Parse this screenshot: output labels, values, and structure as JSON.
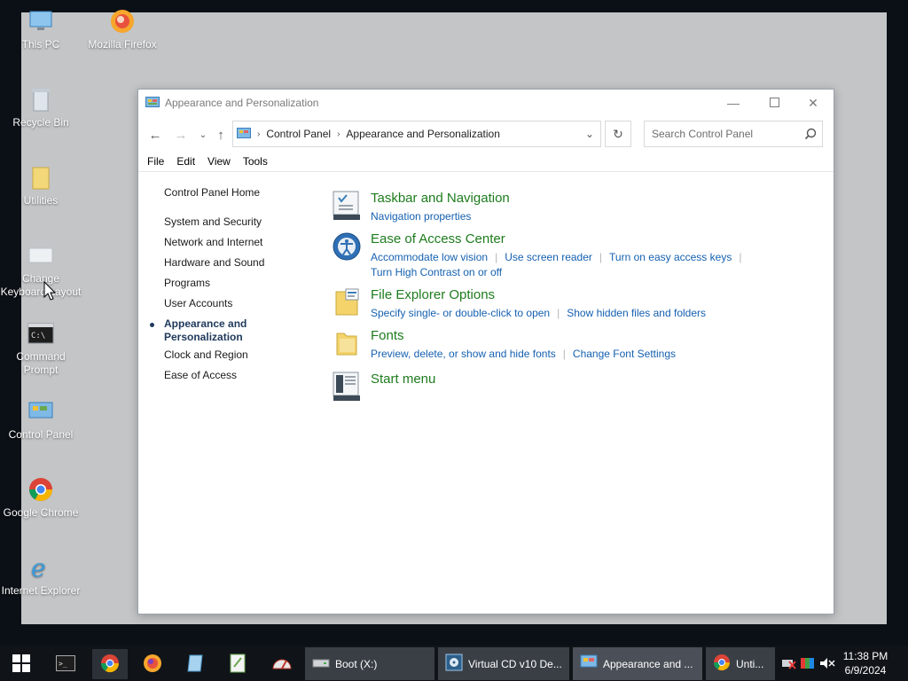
{
  "desktop": {
    "icons": [
      {
        "label": "This PC"
      },
      {
        "label": "Mozilla Firefox"
      },
      {
        "label": "Recycle Bin"
      },
      {
        "label": "Utilities"
      },
      {
        "label": "Change Keyboard Layout"
      },
      {
        "label": "Command Prompt"
      },
      {
        "label": "Control Panel"
      },
      {
        "label": "Google Chrome"
      },
      {
        "label": "Internet Explorer"
      }
    ]
  },
  "window": {
    "title": "Appearance and Personalization",
    "breadcrumb": [
      "Control Panel",
      "Appearance and Personalization"
    ],
    "search_placeholder": "Search Control Panel",
    "menu": [
      "File",
      "Edit",
      "View",
      "Tools"
    ],
    "left_nav": {
      "home": "Control Panel Home",
      "items": [
        "System and Security",
        "Network and Internet",
        "Hardware and Sound",
        "Programs",
        "User Accounts"
      ],
      "current_line1": "Appearance and",
      "current_line2": "Personalization",
      "after": [
        "Clock and Region",
        "Ease of Access"
      ]
    },
    "categories": [
      {
        "title": "Taskbar and Navigation",
        "links": [
          "Navigation properties"
        ]
      },
      {
        "title": "Ease of Access Center",
        "links": [
          "Accommodate low vision",
          "Use screen reader",
          "Turn on easy access keys",
          "Turn High Contrast on or off"
        ]
      },
      {
        "title": "File Explorer Options",
        "links": [
          "Specify single- or double-click to open",
          "Show hidden files and folders"
        ]
      },
      {
        "title": "Fonts",
        "links": [
          "Preview, delete, or show and hide fonts",
          "Change Font Settings"
        ]
      },
      {
        "title": "Start menu",
        "links": []
      }
    ]
  },
  "taskbar": {
    "tasks": [
      {
        "label": "Boot (X:)"
      },
      {
        "label": "Virtual CD v10 De..."
      },
      {
        "label": "Appearance and ..."
      },
      {
        "label": "Unti..."
      }
    ],
    "clock": {
      "time": "11:38 PM",
      "date": "6/9/2024"
    }
  },
  "colors": {
    "category_title": "#1e7c1e",
    "link": "#1560b0",
    "taskbar": "#101418"
  }
}
